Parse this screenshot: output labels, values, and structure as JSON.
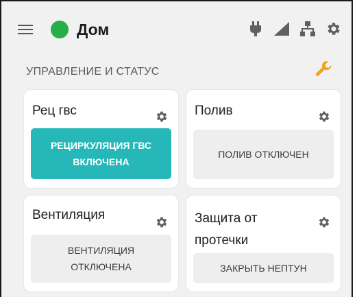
{
  "header": {
    "title": "Дом",
    "status_color": "#27ae49",
    "icons": [
      "menu-icon",
      "power-plug-icon",
      "signal-icon",
      "network-icon",
      "settings-gear-icon"
    ]
  },
  "section": {
    "title": "УПРАВЛЕНИЕ И СТАТУС",
    "tool_icon": "wrench-icon",
    "tool_color": "#f4a11b"
  },
  "cards": [
    {
      "name": "Рец гвс",
      "button_label": "РЕЦИРКУЛЯЦИЯ ГВС ВКЛЮЧЕНА",
      "active": true
    },
    {
      "name": "Полив",
      "button_label": "ПОЛИВ ОТКЛЮЧЕН",
      "active": false
    },
    {
      "name": "Вентиляция",
      "button_label": "ВЕНТИЛЯЦИЯ ОТКЛЮЧЕНА",
      "active": false
    },
    {
      "name": "Защита от протечки",
      "button_label": "ЗАКРЫТЬ НЕПТУН",
      "active": false
    }
  ],
  "colors": {
    "accent": "#26b8b9",
    "background": "#f1f1f1",
    "icon_gray": "#5f5f5f"
  }
}
